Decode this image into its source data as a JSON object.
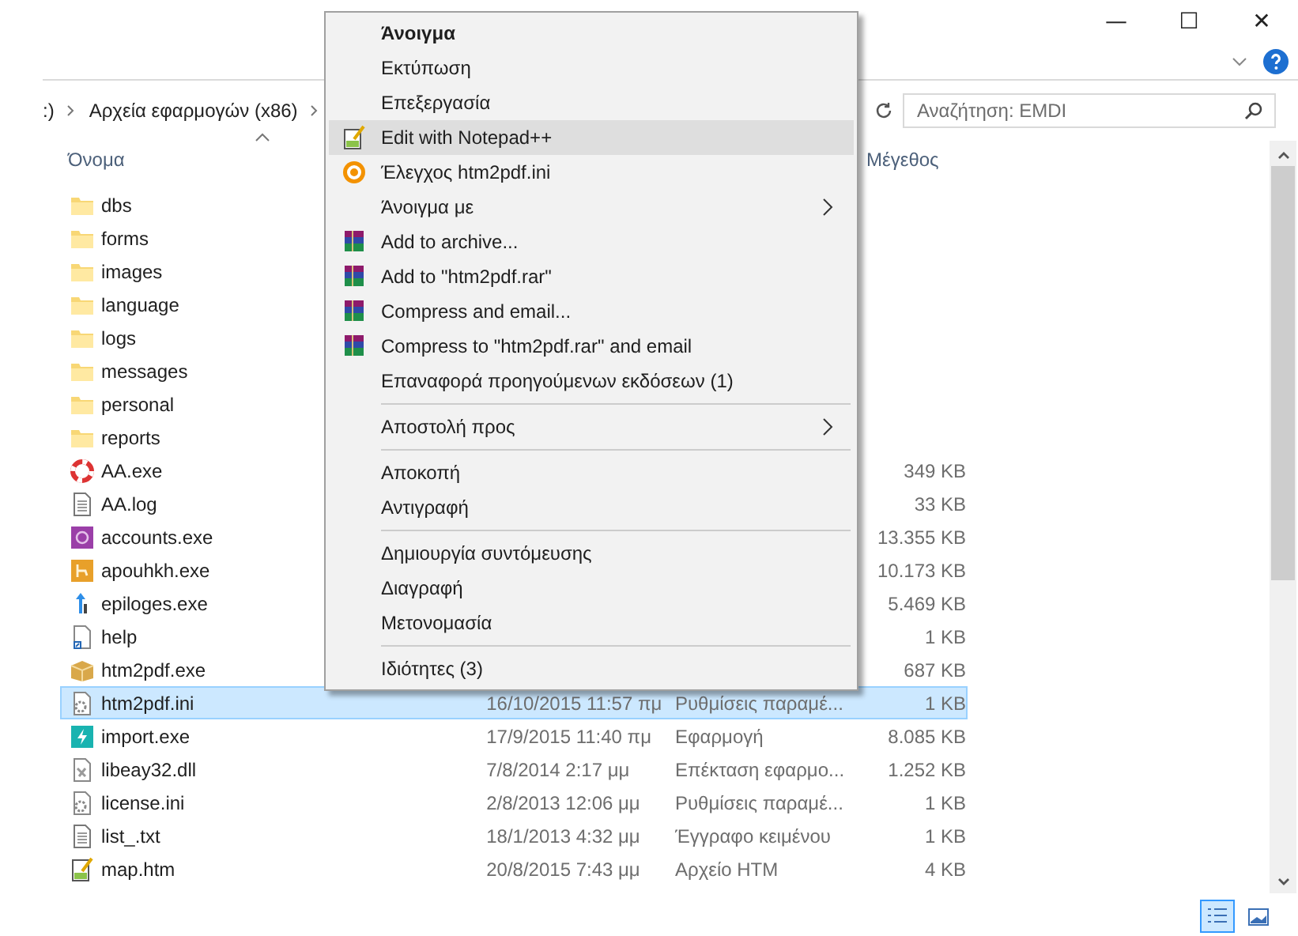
{
  "window": {
    "minimize": "—",
    "maximize": "☐",
    "close": "✕"
  },
  "address": {
    "crumbs": [
      ":)",
      "Αρχεία εφαρμογών (x86)"
    ],
    "search_placeholder": "Αναζήτηση: EMDI"
  },
  "columns": [
    {
      "label": "Όνομα",
      "sorted": true
    },
    {
      "label": "Μέγεθος",
      "sorted": false
    }
  ],
  "files": [
    {
      "kind": "folder",
      "name": "dbs",
      "selected": false
    },
    {
      "kind": "folder",
      "name": "forms",
      "selected": false
    },
    {
      "kind": "folder",
      "name": "images",
      "selected": false
    },
    {
      "kind": "folder",
      "name": "language",
      "selected": false
    },
    {
      "kind": "folder",
      "name": "logs",
      "selected": false
    },
    {
      "kind": "folder",
      "name": "messages",
      "selected": false
    },
    {
      "kind": "folder",
      "name": "personal",
      "selected": false
    },
    {
      "kind": "folder",
      "name": "reports",
      "selected": false
    },
    {
      "kind": "lifebuoy",
      "name": "AA.exe",
      "size": "349 KB",
      "selected": false
    },
    {
      "kind": "text",
      "name": "AA.log",
      "size": "33 KB",
      "selected": false
    },
    {
      "kind": "purple-app",
      "name": "accounts.exe",
      "size": "13.355 KB",
      "selected": false
    },
    {
      "kind": "orange-app",
      "name": "apouhkh.exe",
      "size": "10.173 KB",
      "selected": false
    },
    {
      "kind": "arrows",
      "name": "epiloges.exe",
      "size": "5.469 KB",
      "selected": false
    },
    {
      "kind": "shortcut",
      "name": "help",
      "size": "1 KB",
      "selected": false
    },
    {
      "kind": "package",
      "name": "htm2pdf.exe",
      "size": "687 KB",
      "selected": false
    },
    {
      "kind": "settings",
      "name": "htm2pdf.ini",
      "date": "16/10/2015 11:57 πμ",
      "type": "Ρυθμίσεις παραμέ...",
      "size": "1 KB",
      "selected": true
    },
    {
      "kind": "teal-app",
      "name": "import.exe",
      "date": "17/9/2015 11:40 πμ",
      "type": "Εφαρμογή",
      "size": "8.085 KB",
      "selected": false
    },
    {
      "kind": "dll",
      "name": "libeay32.dll",
      "date": "7/8/2014 2:17 μμ",
      "type": "Επέκταση εφαρμο...",
      "size": "1.252 KB",
      "selected": false
    },
    {
      "kind": "settings",
      "name": "license.ini",
      "date": "2/8/2013 12:06 μμ",
      "type": "Ρυθμίσεις παραμέ...",
      "size": "1 KB",
      "selected": false
    },
    {
      "kind": "text",
      "name": "list_.txt",
      "date": "18/1/2013 4:32 μμ",
      "type": "Έγγραφο κειμένου",
      "size": "1 KB",
      "selected": false
    },
    {
      "kind": "htm",
      "name": "map.htm",
      "date": "20/8/2015 7:43 μμ",
      "type": "Αρχείο HTM",
      "size": "4 KB",
      "selected": false
    }
  ],
  "context_menu": [
    {
      "kind": "plain",
      "label": "Άνοιγμα",
      "default": true,
      "selected": false,
      "submenu": false
    },
    {
      "kind": "plain",
      "label": "Εκτύπωση",
      "default": false,
      "selected": false,
      "submenu": false
    },
    {
      "kind": "plain",
      "label": "Επεξεργασία",
      "default": false,
      "selected": false,
      "submenu": false
    },
    {
      "kind": "notepad",
      "label": "Edit with Notepad++",
      "default": false,
      "selected": true,
      "submenu": false
    },
    {
      "kind": "scanner",
      "label": "Έλεγχος htm2pdf.ini",
      "default": false,
      "selected": false,
      "submenu": false
    },
    {
      "kind": "plain",
      "label": "Άνοιγμα με",
      "default": false,
      "selected": false,
      "submenu": true
    },
    {
      "kind": "archive",
      "label": "Add to archive...",
      "default": false,
      "selected": false,
      "submenu": false
    },
    {
      "kind": "archive",
      "label": "Add to \"htm2pdf.rar\"",
      "default": false,
      "selected": false,
      "submenu": false
    },
    {
      "kind": "archive",
      "label": "Compress and email...",
      "default": false,
      "selected": false,
      "submenu": false
    },
    {
      "kind": "archive",
      "label": "Compress to \"htm2pdf.rar\" and email",
      "default": false,
      "selected": false,
      "submenu": false
    },
    {
      "kind": "plain",
      "label": "Επαναφορά προηγούμενων εκδόσεων (1)",
      "default": false,
      "selected": false,
      "submenu": false
    },
    {
      "kind": "separator"
    },
    {
      "kind": "plain",
      "label": "Αποστολή προς",
      "default": false,
      "selected": false,
      "submenu": true
    },
    {
      "kind": "separator"
    },
    {
      "kind": "plain",
      "label": "Αποκοπή",
      "default": false,
      "selected": false,
      "submenu": false
    },
    {
      "kind": "plain",
      "label": "Αντιγραφή",
      "default": false,
      "selected": false,
      "submenu": false
    },
    {
      "kind": "separator"
    },
    {
      "kind": "plain",
      "label": "Δημιουργία συντόμευσης",
      "default": false,
      "selected": false,
      "submenu": false
    },
    {
      "kind": "plain",
      "label": "Διαγραφή",
      "default": false,
      "selected": false,
      "submenu": false
    },
    {
      "kind": "plain",
      "label": "Μετονομασία",
      "default": false,
      "selected": false,
      "submenu": false
    },
    {
      "kind": "separator"
    },
    {
      "kind": "plain",
      "label": "Ιδιότητες (3)",
      "default": false,
      "selected": false,
      "submenu": false
    }
  ],
  "views": [
    {
      "selected": true
    },
    {
      "selected": false
    }
  ]
}
